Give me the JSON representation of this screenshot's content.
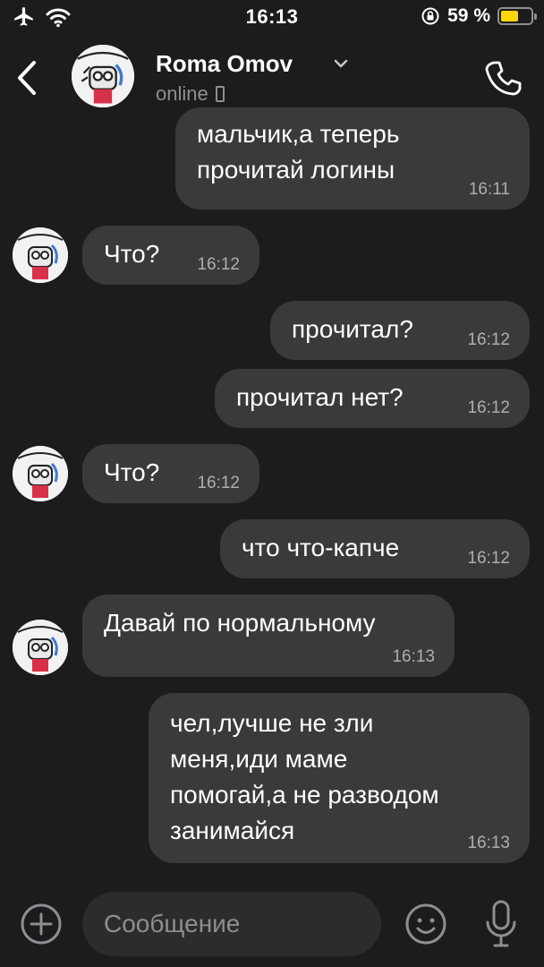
{
  "status_bar": {
    "time": "16:13",
    "battery_text": "59 %",
    "battery_level": 0.59
  },
  "header": {
    "contact_name": "Roma Omov",
    "contact_status": "online"
  },
  "messages": [
    {
      "side": "out",
      "lines": [
        "мальчик,а теперь",
        "прочитай логины"
      ],
      "time": "16:11"
    },
    {
      "side": "in",
      "lines": [
        "Что?"
      ],
      "time": "16:12"
    },
    {
      "side": "out",
      "lines": [
        "прочитал?"
      ],
      "time": "16:12"
    },
    {
      "side": "out",
      "lines": [
        "прочитал нет?"
      ],
      "time": "16:12"
    },
    {
      "side": "in",
      "lines": [
        "Что?"
      ],
      "time": "16:12"
    },
    {
      "side": "out",
      "lines": [
        "что что-капче"
      ],
      "time": "16:12"
    },
    {
      "side": "in",
      "lines": [
        "Давай по нормальному"
      ],
      "time": "16:13"
    },
    {
      "side": "out",
      "lines": [
        "чел,лучше не зли",
        "меня,иди маме",
        "помогай,а не разводом",
        "занимайся"
      ],
      "time": "16:13"
    }
  ],
  "input": {
    "placeholder": "Сообщение"
  },
  "colors": {
    "background": "#1c1c1e",
    "bubble": "#3a3a3c",
    "battery": "#ffd60a"
  }
}
